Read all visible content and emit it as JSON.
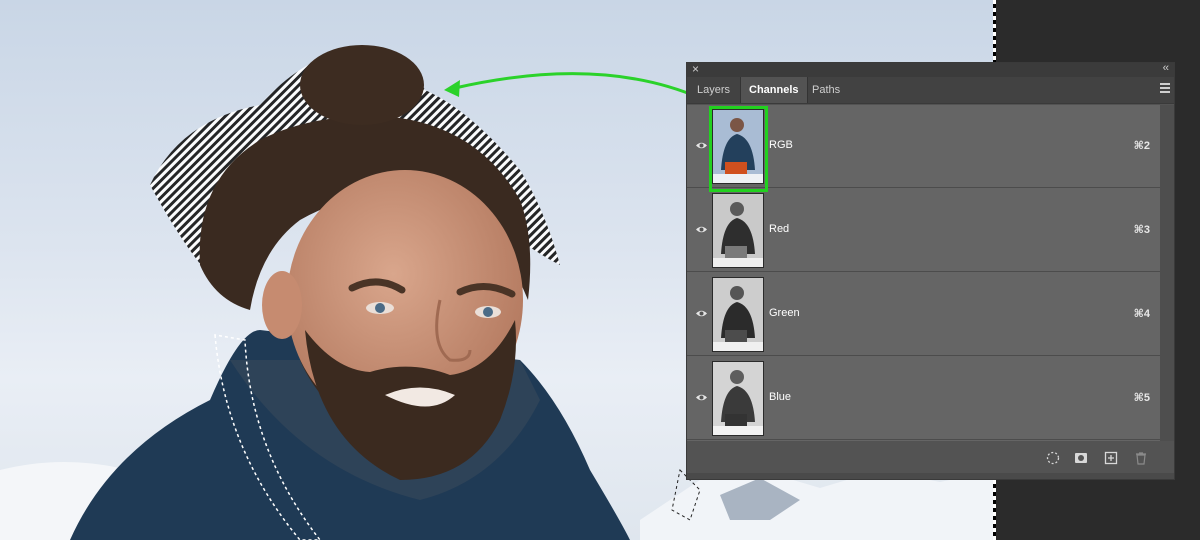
{
  "panel": {
    "tabs": [
      {
        "label": "Layers",
        "active": false
      },
      {
        "label": "Channels",
        "active": true
      },
      {
        "label": "Paths",
        "active": false
      }
    ],
    "close_icon": "close-icon",
    "collapse_icon": "double-chevron-icon",
    "menu_icon": "panel-menu-icon",
    "channels": [
      {
        "name": "RGB",
        "shortcut": "⌘2",
        "visible": true,
        "highlighted": true
      },
      {
        "name": "Red",
        "shortcut": "⌘3",
        "visible": true
      },
      {
        "name": "Green",
        "shortcut": "⌘4",
        "visible": true
      },
      {
        "name": "Blue",
        "shortcut": "⌘5",
        "visible": true
      }
    ],
    "footer_icons": [
      "load-selection-icon",
      "save-selection-icon",
      "new-channel-icon",
      "trash-icon"
    ]
  },
  "colors": {
    "highlight": "#22d11f",
    "arrow": "#2bd22a",
    "panel_bg": "#535353",
    "row_bg": "#656565"
  }
}
